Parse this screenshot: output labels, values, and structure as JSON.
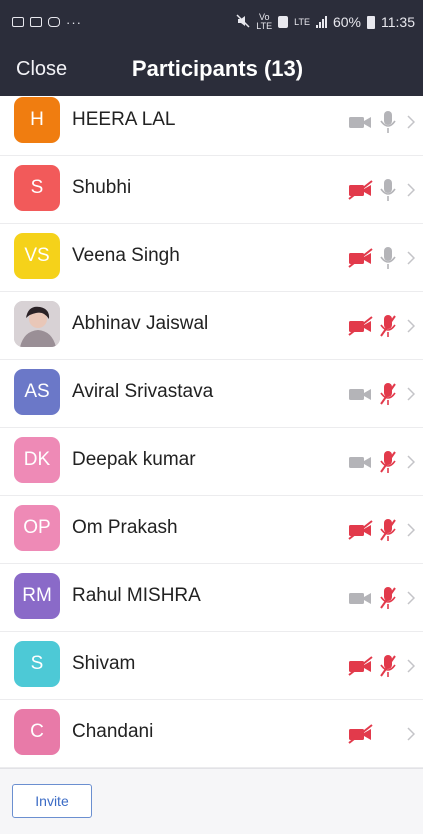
{
  "status_bar": {
    "time": "11:35",
    "battery_percent": "60%",
    "network": "LTE",
    "left_icons": [
      "notification-icon",
      "gallery-icon",
      "youtube-icon",
      "more-dots-icon"
    ],
    "right_icons": [
      "mute-icon",
      "volte-icon",
      "sim-icon",
      "lte-signal-icon",
      "battery-icon"
    ]
  },
  "header": {
    "close_label": "Close",
    "title": "Participants (13)"
  },
  "colors": {
    "header_bg": "#2b2d3a",
    "muted_red": "#e23a4b",
    "icon_gray": "#b4b4b8",
    "accent_blue": "#3b6bc5"
  },
  "participants": [
    {
      "initials": "H",
      "name": "HEERA LAL",
      "avatar_color": "#f07d10",
      "video_muted": false,
      "audio_muted": false,
      "has_audio": true,
      "photo": false
    },
    {
      "initials": "S",
      "name": "Shubhi",
      "avatar_color": "#f25a5a",
      "video_muted": true,
      "audio_muted": false,
      "has_audio": true,
      "photo": false
    },
    {
      "initials": "VS",
      "name": "Veena Singh",
      "avatar_color": "#f5d21a",
      "video_muted": true,
      "audio_muted": false,
      "has_audio": true,
      "photo": false
    },
    {
      "initials": "",
      "name": "Abhinav Jaiswal",
      "avatar_color": "#c9c3c6",
      "video_muted": true,
      "audio_muted": true,
      "has_audio": true,
      "photo": true
    },
    {
      "initials": "AS",
      "name": "Aviral Srivastava",
      "avatar_color": "#6b78c8",
      "video_muted": false,
      "audio_muted": true,
      "has_audio": true,
      "photo": false
    },
    {
      "initials": "DK",
      "name": "Deepak kumar",
      "avatar_color": "#ee8ab6",
      "video_muted": false,
      "audio_muted": true,
      "has_audio": true,
      "photo": false
    },
    {
      "initials": "OP",
      "name": "Om Prakash",
      "avatar_color": "#ee8ab6",
      "video_muted": true,
      "audio_muted": true,
      "has_audio": true,
      "photo": false
    },
    {
      "initials": "RM",
      "name": "Rahul MISHRA",
      "avatar_color": "#8a6ac8",
      "video_muted": false,
      "audio_muted": true,
      "has_audio": true,
      "photo": false
    },
    {
      "initials": "S",
      "name": "Shivam",
      "avatar_color": "#4dc9d6",
      "video_muted": true,
      "audio_muted": true,
      "has_audio": true,
      "photo": false
    },
    {
      "initials": "C",
      "name": "Chandani",
      "avatar_color": "#e87aa8",
      "video_muted": true,
      "audio_muted": false,
      "has_audio": false,
      "photo": false
    }
  ],
  "footer": {
    "invite_label": "Invite"
  }
}
